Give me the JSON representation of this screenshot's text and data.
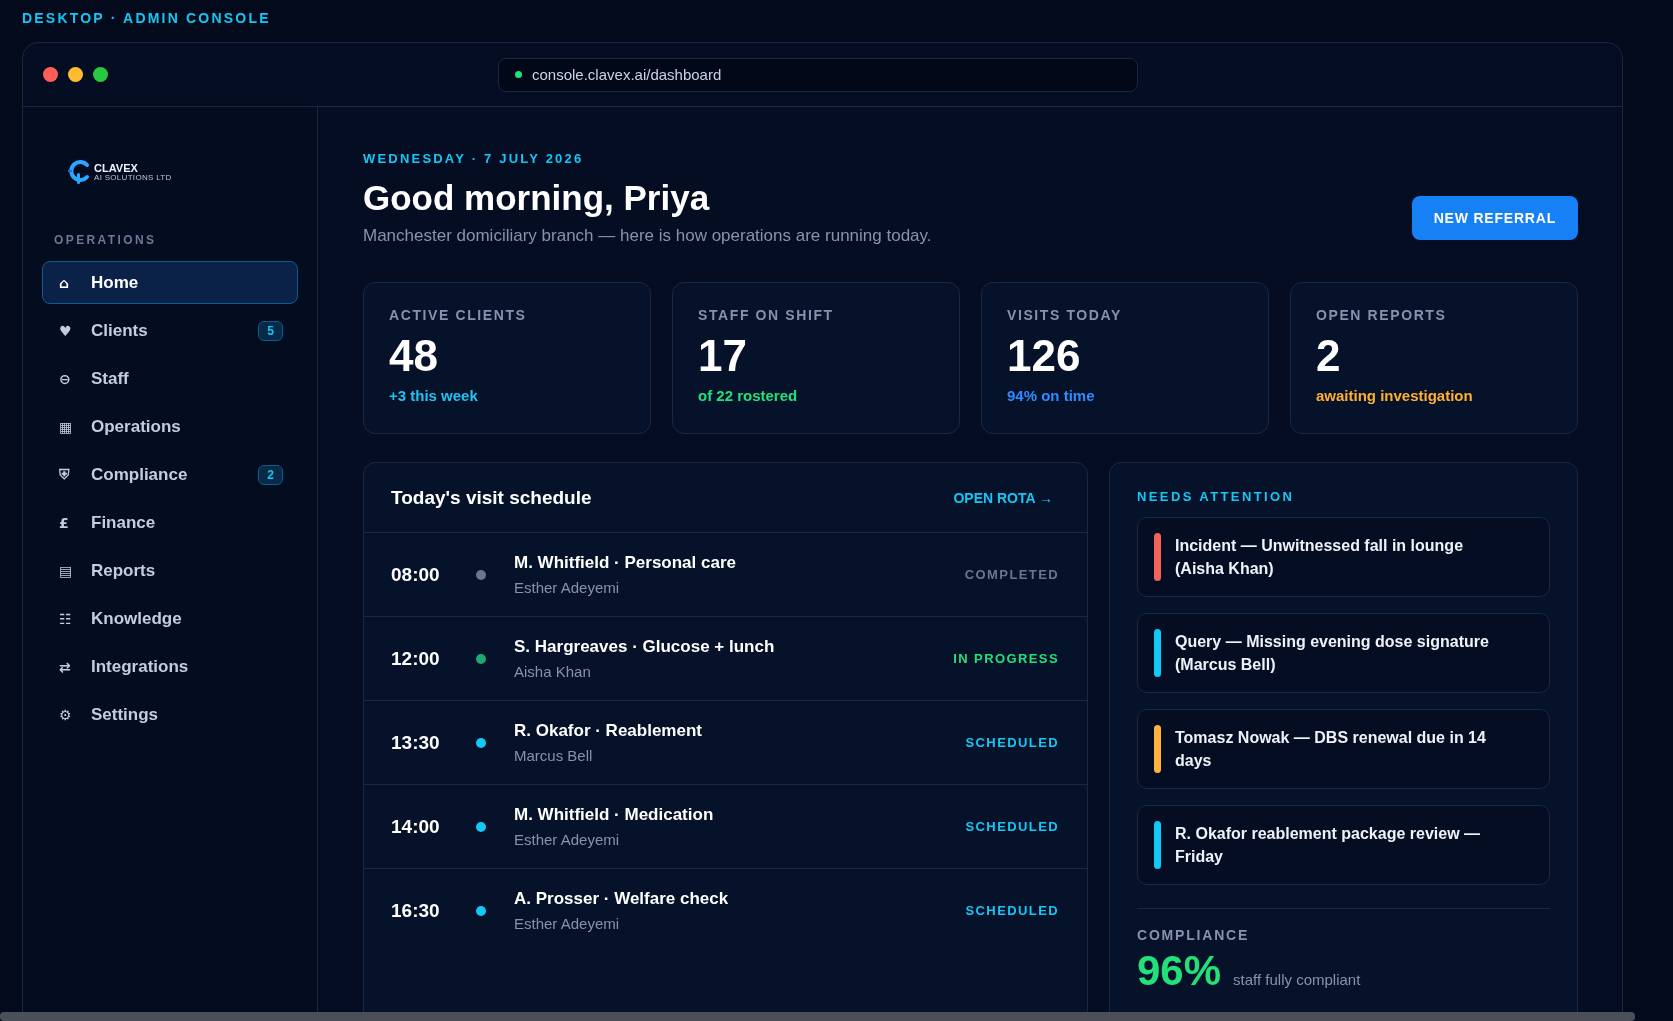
{
  "page_label": "DESKTOP · ADMIN CONSOLE",
  "window": {
    "controls": [
      {
        "kind": "close"
      },
      {
        "kind": "minimize"
      },
      {
        "kind": "zoom"
      }
    ],
    "address": "console.clavex.ai/dashboard"
  },
  "sidebar": {
    "logo": {
      "name": "CLAVEX",
      "tagline": "AI SOLUTIONS LTD"
    },
    "section": "OPERATIONS",
    "items": [
      {
        "icon": "⌂",
        "label": "Home",
        "selected": true
      },
      {
        "icon": "♥",
        "label": "Clients",
        "selected": false,
        "badge": "5"
      },
      {
        "icon": "⊖",
        "label": "Staff",
        "selected": false
      },
      {
        "icon": "▦",
        "label": "Operations",
        "selected": false
      },
      {
        "icon": "⛨",
        "label": "Compliance",
        "selected": false,
        "badge": "2"
      },
      {
        "icon": "£",
        "label": "Finance",
        "selected": false
      },
      {
        "icon": "▤",
        "label": "Reports",
        "selected": false
      },
      {
        "icon": "☷",
        "label": "Knowledge",
        "selected": false
      },
      {
        "icon": "⇄",
        "label": "Integrations",
        "selected": false
      },
      {
        "icon": "⚙",
        "label": "Settings",
        "selected": false
      }
    ]
  },
  "header": {
    "date": "WEDNESDAY · 7 JULY 2026",
    "greeting": "Good morning, Priya",
    "subtitle": "Manchester domiciliary branch — here is how operations are running today.",
    "action": "NEW REFERRAL"
  },
  "stats": [
    {
      "label": "ACTIVE CLIENTS",
      "value": "48",
      "note": "+3 this week",
      "color": "#22c3f0"
    },
    {
      "label": "STAFF ON SHIFT",
      "value": "17",
      "note": "of 22 rostered",
      "color": "#22e07a"
    },
    {
      "label": "VISITS TODAY",
      "value": "126",
      "note": "94% on time",
      "color": "#2d8cff"
    },
    {
      "label": "OPEN REPORTS",
      "value": "2",
      "note": "awaiting investigation",
      "color": "#ffb02e"
    }
  ],
  "schedule": {
    "title": "Today's visit schedule",
    "link": "OPEN ROTA →",
    "rows": [
      {
        "time": "08:00",
        "visit": "M. Whitfield · Personal care",
        "carer": "Esther Adeyemi",
        "status": "COMPLETED",
        "kind": "completed"
      },
      {
        "time": "12:00",
        "visit": "S. Hargreaves · Glucose + lunch",
        "carer": "Aisha Khan",
        "status": "IN PROGRESS",
        "kind": "in_progress"
      },
      {
        "time": "13:30",
        "visit": "R. Okafor · Reablement",
        "carer": "Marcus Bell",
        "status": "SCHEDULED",
        "kind": "scheduled"
      },
      {
        "time": "14:00",
        "visit": "M. Whitfield · Medication",
        "carer": "Esther Adeyemi",
        "status": "SCHEDULED",
        "kind": "scheduled"
      },
      {
        "time": "16:30",
        "visit": "A. Prosser · Welfare check",
        "carer": "Esther Adeyemi",
        "status": "SCHEDULED",
        "kind": "scheduled"
      }
    ]
  },
  "attention": {
    "title": "NEEDS ATTENTION",
    "items": [
      {
        "text": "Incident — Unwitnessed fall in lounge (Aisha Khan)",
        "color": "#f2645a"
      },
      {
        "text": "Query — Missing evening dose signature (Marcus Bell)",
        "color": "#14c8f5"
      },
      {
        "text": "Tomasz Nowak — DBS renewal due in 14 days",
        "color": "#ffb23c"
      },
      {
        "text": "R. Okafor reablement package review — Friday",
        "color": "#14c8f5"
      }
    ],
    "compliance": {
      "label": "COMPLIANCE",
      "value": "96%",
      "note": "staff fully compliant"
    }
  }
}
